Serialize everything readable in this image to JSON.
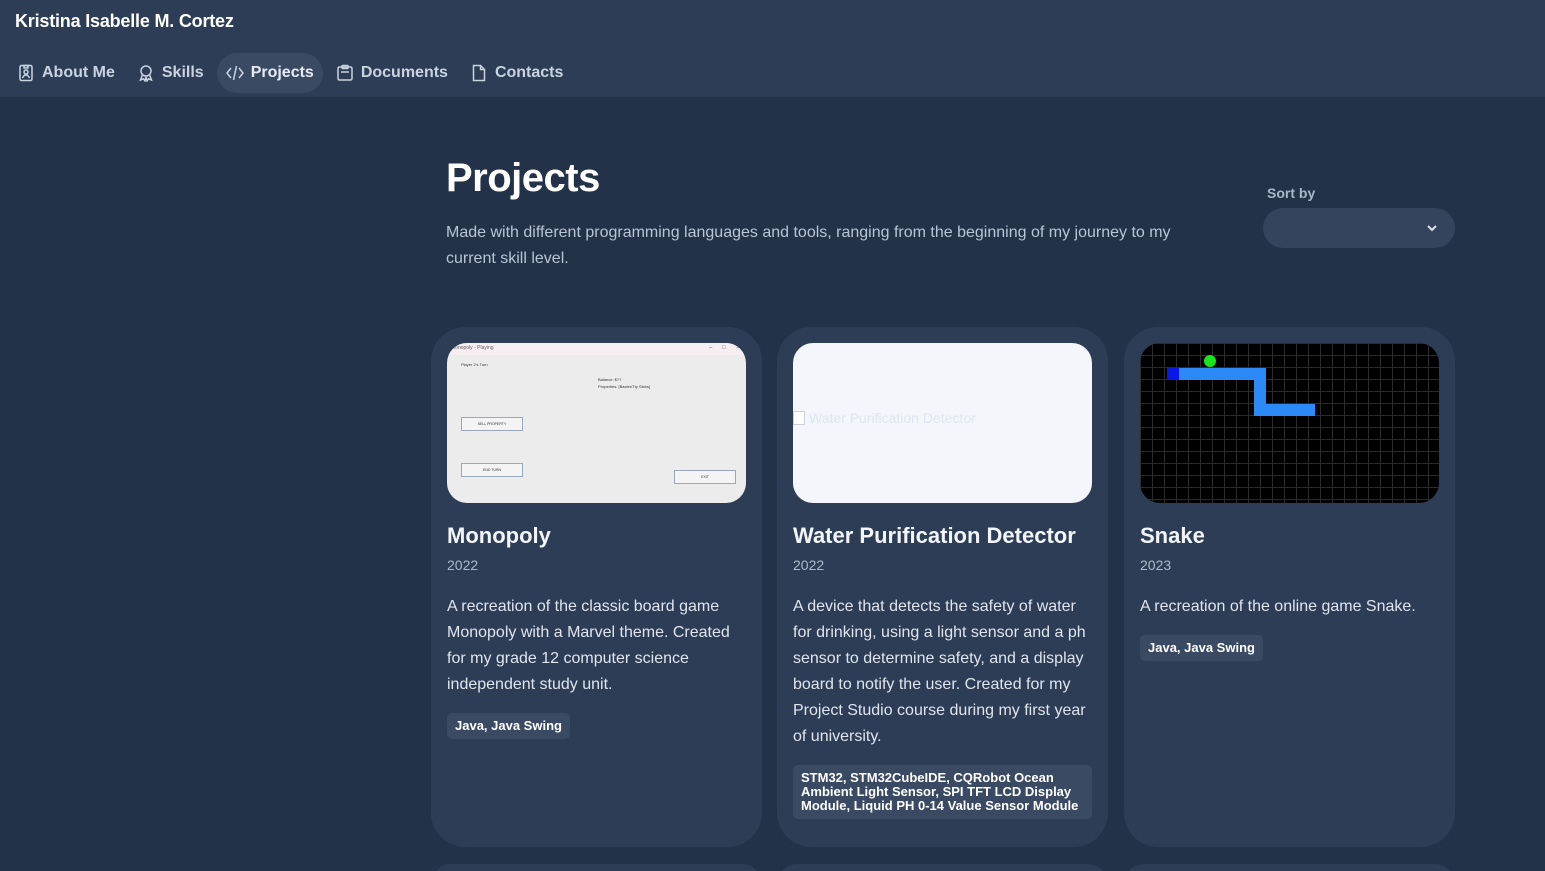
{
  "header": {
    "brand": "Kristina Isabelle M. Cortez",
    "nav": [
      {
        "label": "About Me",
        "icon": "badge-icon",
        "active": false
      },
      {
        "label": "Skills",
        "icon": "award-icon",
        "active": false
      },
      {
        "label": "Projects",
        "icon": "code-icon",
        "active": true
      },
      {
        "label": "Documents",
        "icon": "clipboard-icon",
        "active": false
      },
      {
        "label": "Contacts",
        "icon": "file-icon",
        "active": false
      }
    ]
  },
  "main": {
    "title": "Projects",
    "description": "Made with different programming languages and tools, ranging from the beginning of my journey to my current skill level.",
    "sort": {
      "label": "Sort by",
      "value": ""
    }
  },
  "projects": [
    {
      "title": "Monopoly",
      "year": "2022",
      "description": "A recreation of the classic board game Monopoly with a Marvel theme. Created for my grade 12 computer science independent study unit.",
      "tags": "Java, Java Swing",
      "thumb": {
        "window_title": "Monopoly - Playing",
        "turn": "Player 2's Turn",
        "balance": "Balance: $??",
        "properties": "Properties: [Baxter/Tty Slebs]",
        "sell_button": "SELL PROPERTY",
        "end_turn_button": "END TURN",
        "exit_button": "EXIT"
      }
    },
    {
      "title": "Water Purification Detector",
      "year": "2022",
      "description": "A device that detects the safety of water for drinking, using a light sensor and a ph sensor to determine safety, and a display board to notify the user. Created for my Project Studio course during my first year of university.",
      "tags": "STM32, STM32CubeIDE, CQRobot Ocean Ambient Light Sensor, SPI TFT LCD Display Module, Liquid PH 0-14 Value Sensor Module",
      "thumb": {
        "alt": "Water Purification Detector"
      }
    },
    {
      "title": "Snake",
      "year": "2023",
      "description": "A recreation of the online game Snake.",
      "tags": "Java, Java Swing"
    }
  ],
  "colors": {
    "background": "#233149",
    "surface": "#2d3d55",
    "chip": "#3a4a63",
    "snake_body": "#2b8af7",
    "snake_head": "#0a18e6",
    "snake_food": "#19e619"
  }
}
